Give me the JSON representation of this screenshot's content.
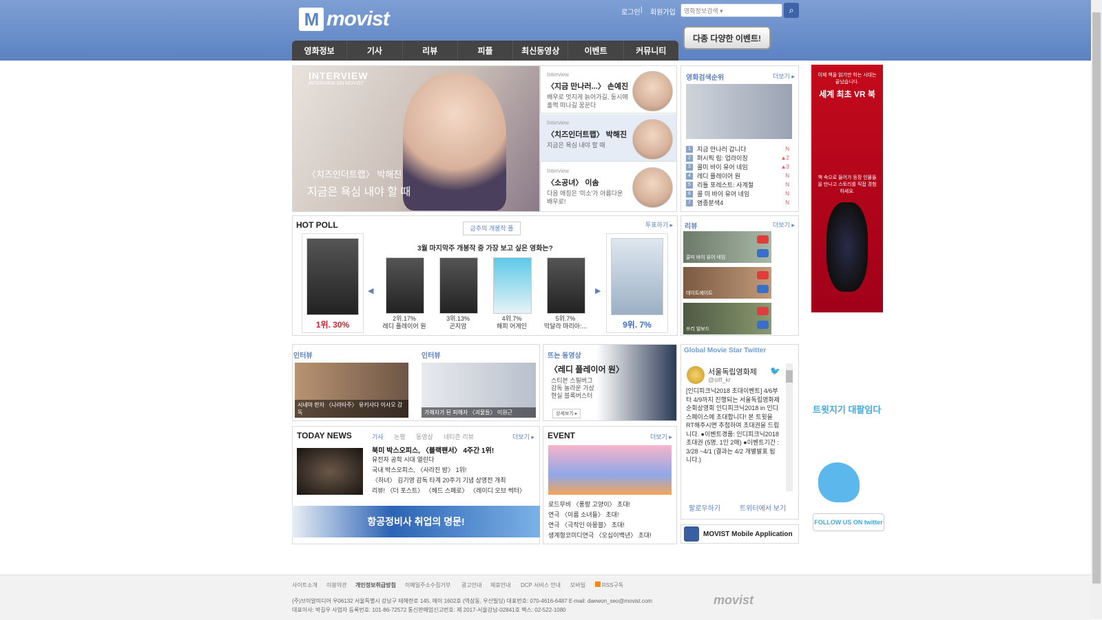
{
  "header": {
    "logo": "movist",
    "login": "로그인",
    "join": "회원가입",
    "search_placeholder": "영화정보검색 ▾",
    "event_banner": "다종 다양한 이벤트!"
  },
  "nav": [
    "영화정보",
    "기사",
    "리뷰",
    "피플",
    "최신동영상",
    "이벤트",
    "커뮤니티"
  ],
  "hero": {
    "tag": "INTERVIEW",
    "tag_sub": "INTERVIEW ON MOVIST",
    "title": "〈치즈인더트랩〉 박해진",
    "subtitle": "지금은 욕심 내야 할 때"
  },
  "interviews": [
    {
      "label": "Interview",
      "title": "〈지금 만나러...〉 손예진",
      "desc": "배우로 멋지게 늙어가길, 동시에 훌쩍 떠나길 꿈꾼다"
    },
    {
      "label": "Interview",
      "title": "〈치즈인더트랩〉 박해진",
      "desc": "지금은 욕심 내야 할 때"
    },
    {
      "label": "Interview",
      "title": "〈소공녀〉 이솜",
      "desc": "다음 애칭은 '미소'가 아름다운 배우로!"
    }
  ],
  "ranking": {
    "title": "영화검색순위",
    "more": "더보기 ▸",
    "items": [
      {
        "num": "1",
        "title": "지금 만나러 갑니다",
        "status": "N"
      },
      {
        "num": "2",
        "title": "퍼시픽 림: 업라이징",
        "status": "▲2"
      },
      {
        "num": "3",
        "title": "콜미 바이 유어 네임",
        "status": "▲3"
      },
      {
        "num": "4",
        "title": "레디 플레이어 원",
        "status": "N"
      },
      {
        "num": "5",
        "title": "리틀 포레스트: 사계절",
        "status": "N"
      },
      {
        "num": "6",
        "title": "콜 미 바이 유어 네임",
        "status": "N"
      },
      {
        "num": "7",
        "title": "염종분색4",
        "status": "N"
      }
    ]
  },
  "poll": {
    "title": "HOT POLL",
    "tab": "금주의 개봉작 폴",
    "more": "투표하기 ▸",
    "question": "3월 마지막주 개봉작 중 가장 보고 싶은 영화는?",
    "first": "1위. 30%",
    "last": "9위. 7%",
    "items": [
      {
        "rank": "2위.17%",
        "title": "레디 플레이어 원"
      },
      {
        "rank": "3위.13%",
        "title": "곤지암"
      },
      {
        "rank": "4위.7%",
        "title": "해피 어게인"
      },
      {
        "rank": "5위.7%",
        "title": "막달라 마리아:..."
      }
    ]
  },
  "reviews": {
    "title": "리뷰",
    "more": "더보기 ▸",
    "items": [
      "콜미 바이 유어 네임",
      "데이트에이트",
      "쓰리 빌보드"
    ]
  },
  "interview_boxes": [
    {
      "title": "인터뷰",
      "caption": "시네마 판자 〈나라타주〉 유키사다 이사오 감독"
    },
    {
      "title": "인터뷰",
      "caption": "가해자가 된 피해자 〈괴물들〉 이원근"
    }
  ],
  "video": {
    "title": "뜨는 동영상",
    "headline": "〈레디 플레이어 원〉",
    "desc": "스티븐 스필버그 감독 놀라운 가상현실 블록버스터",
    "detail": "상세보기 ▸"
  },
  "twitter": {
    "title": "Global Movie Star Twitter",
    "name": "서울독립영화제",
    "handle": "@siff_kr",
    "text": "[인디피크닉2018 초대이벤트] 4/6부터 4/9까지 진행되는 서울독립영화제 순회상영회 인디피크닉2018 in 인디스페이스에 초대합니다! 본 트윗을 RT해주시면 추첨하여 초대권을 드립니다. ●이벤트경품: 인디피크닉2018 초대권 (5명, 1인 2매) ●이벤트기간 : 3/28 ~4/1 (결과는 4/2 개별발표 됩니다.)",
    "follow": "팔로우하기",
    "view": "트위터에서 보기",
    "mobile": "MOVIST Mobile Application"
  },
  "news": {
    "title": "TODAY NEWS",
    "tabs": [
      "기사",
      "논평",
      "동영상",
      "네티즌 리뷰"
    ],
    "more": "더보기 ▸",
    "items": [
      "북미 박스오피스, 〈블랙팬서〉 4주간 1위!",
      "유전자 공학 시대 열린다",
      "국내 박스오피스, 〈사라진 밤〉 1위!",
      "〈하녀〉 김기영 감독 타계 20주기 기념 상영전 개최",
      "리뷰! 〈더 포스트〉 〈헤드 스페로〉 〈레이디 오브 썩터〉"
    ]
  },
  "event": {
    "title": "EVENT",
    "more": "더보기 ▸",
    "items": [
      "로드무비 〈퐁팡 고양이〉 초대!",
      "연극 〈이름 소녀들〉 초대!",
      "연극 〈극작인 아몽블〉 초대!",
      "생계형코미디연극 〈오십이백년〉 초대!"
    ]
  },
  "ads": {
    "vr_title": "세계 최초 VR 북",
    "vr_top": "이제 책을 읽기만 하는 시대는 끝났습니다.",
    "vr_desc": "책 속으로 들어가 등장 인물들을 만나고 스토리를 직접 경험하세요.",
    "bottom": "항공정비사 취업의 명문!",
    "twitter_title": "트윗지기 대팔임다",
    "twitter_follow": "FOLLOW US ON twitter"
  },
  "footer": {
    "links": [
      "사이트소개",
      "이용약관",
      "개인정보취급방침",
      "이메일주소수집거부",
      "광고안내",
      "제휴안내",
      "DCP 서비스 안내",
      "모바일",
      "RSS구독"
    ],
    "company": "(주)브이알미디어  우06132 서울특별시 강남구 테헤란로 145, 에이 1602호 (역삼동, 우신빌딩)  대표번호: 070-4616-6487  E-mail: daewon_seo@movist.com",
    "company2": "대표이사: 박길우  사업자 등록번호: 101-86-72572  통신판매업신고번호: 제 2017-서울강남-02841호  팩스: 02-522-1080",
    "logo": "movist"
  }
}
